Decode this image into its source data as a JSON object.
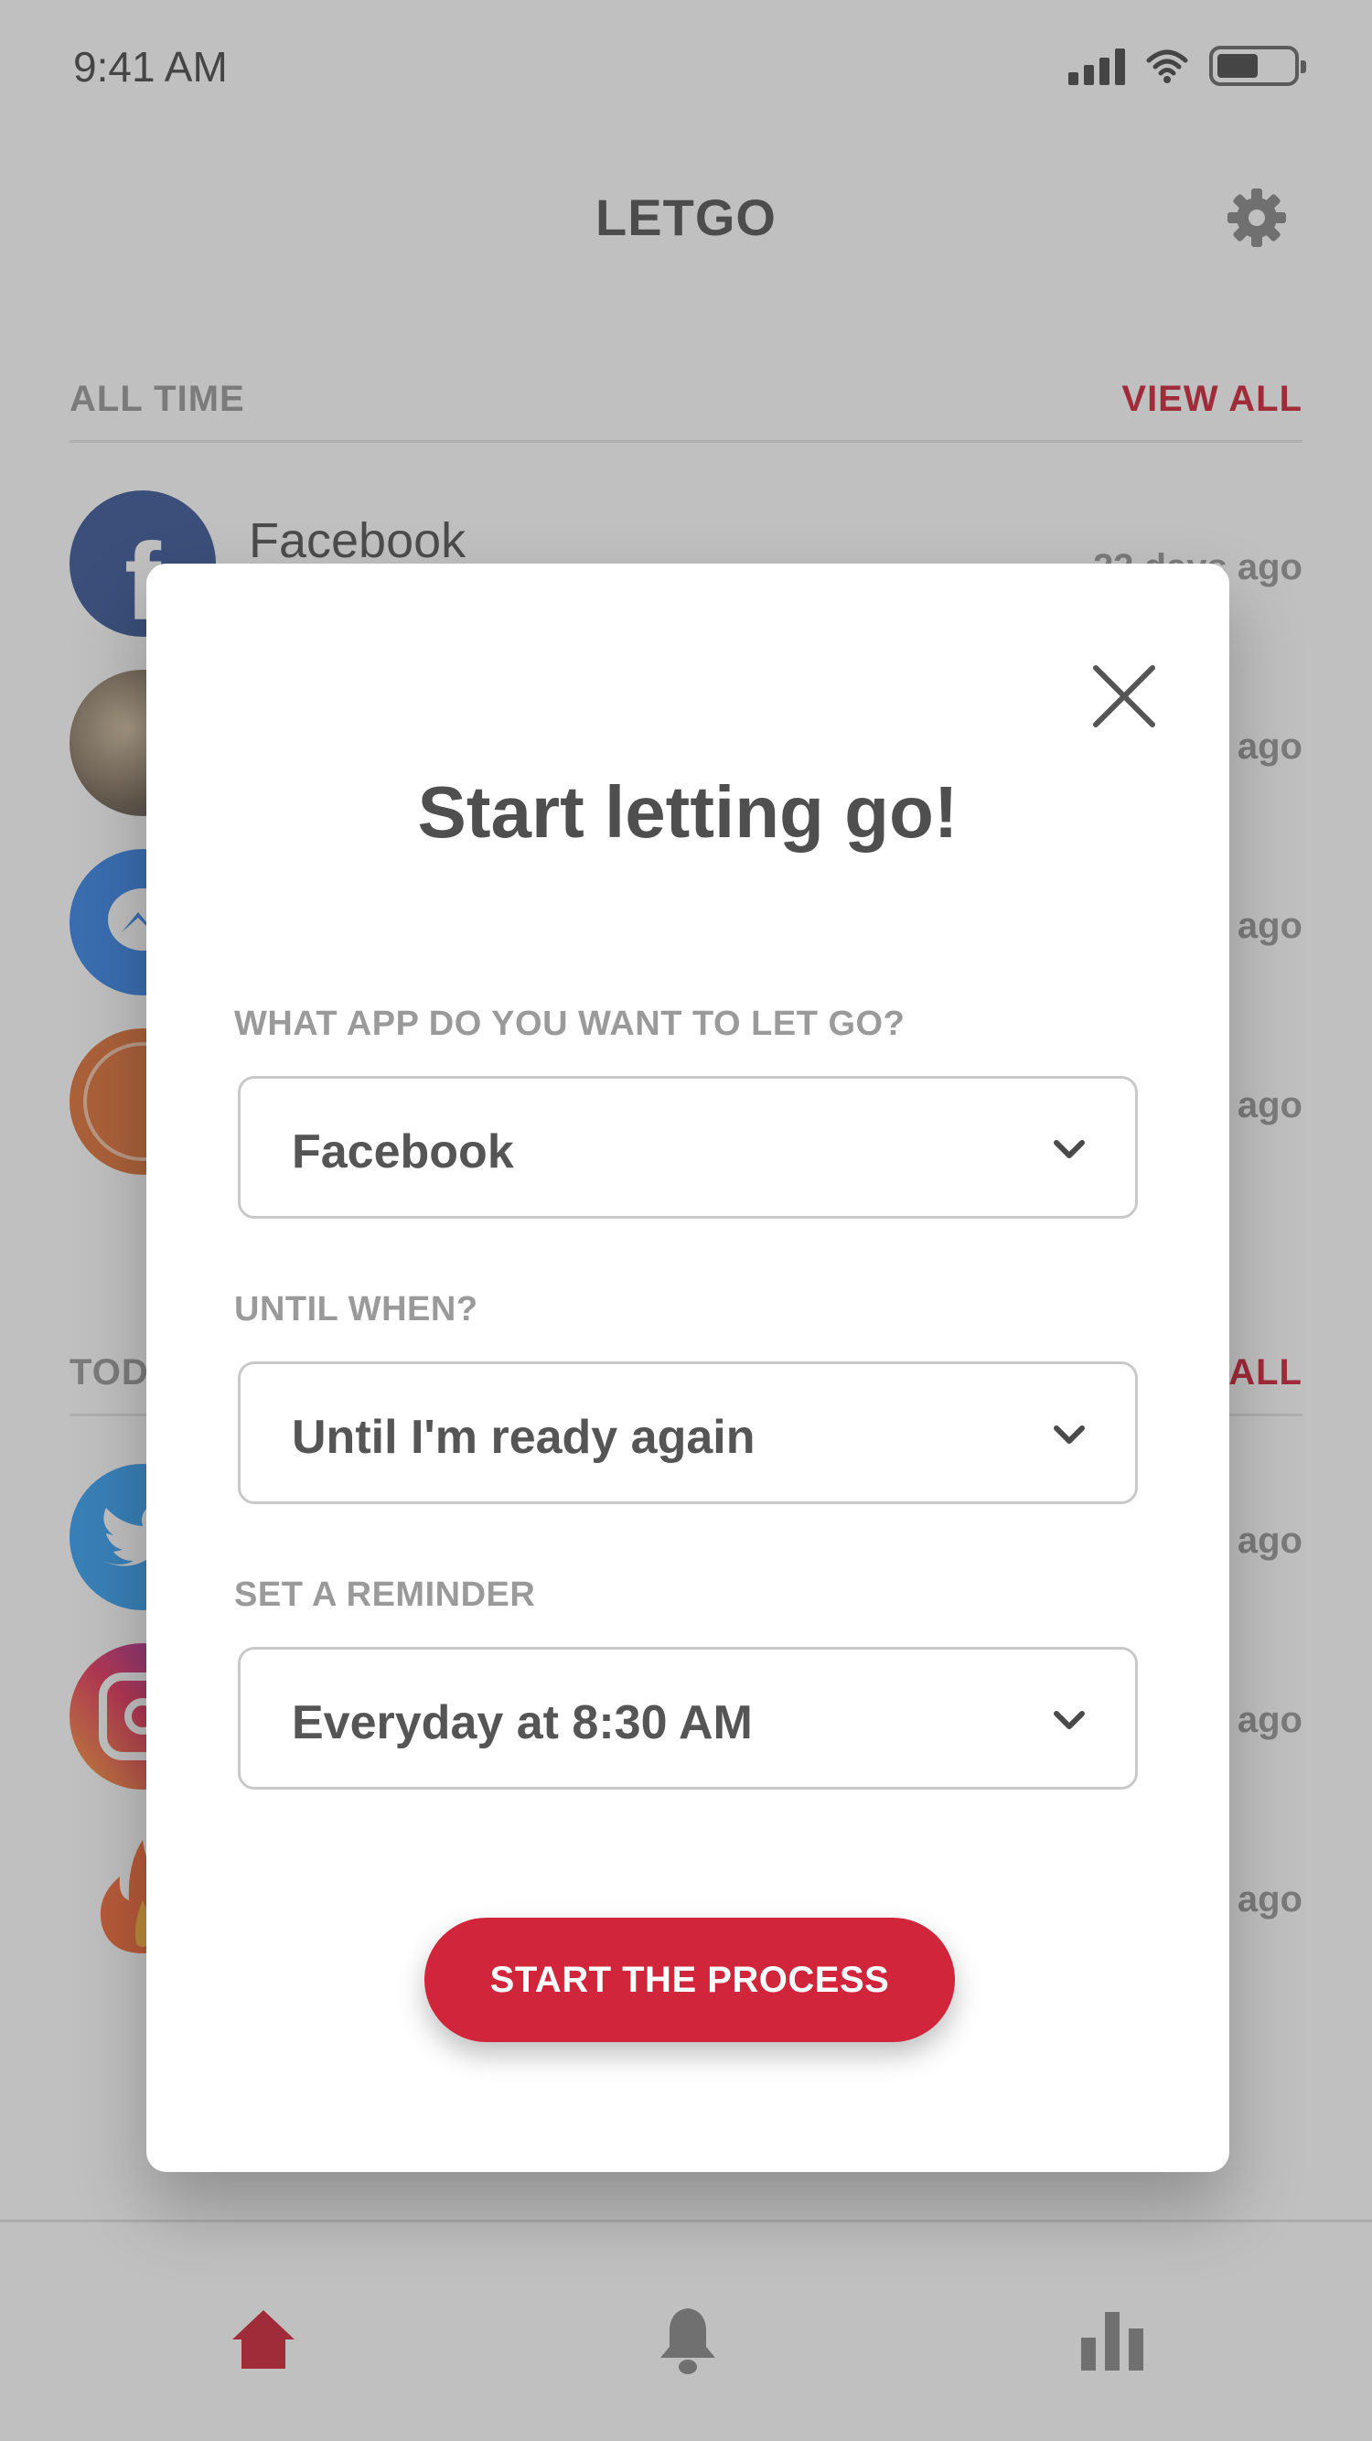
{
  "status_bar": {
    "time": "9:41 AM"
  },
  "header": {
    "title": "LETGO",
    "settings_icon": "gear-icon"
  },
  "all_time": {
    "label": "ALL TIME",
    "action": "VIEW ALL",
    "items": [
      {
        "name": "Facebook",
        "time": "23 days ago",
        "icon": "facebook-icon"
      },
      {
        "name": "",
        "time": "ago",
        "icon": "game-avatar-icon"
      },
      {
        "name": "",
        "time": "ago",
        "icon": "messenger-icon"
      },
      {
        "name": "",
        "time": "ago",
        "icon": "app-la-icon"
      }
    ]
  },
  "today": {
    "label": "TOD",
    "action": "ALL",
    "items": [
      {
        "time": "ago",
        "icon": "twitter-icon"
      },
      {
        "time": "ago",
        "icon": "instagram-icon"
      },
      {
        "time": "ago",
        "icon": "tinder-icon"
      }
    ]
  },
  "bottom_nav": {
    "items": [
      {
        "icon": "home-icon",
        "active": true
      },
      {
        "icon": "bell-icon",
        "active": false
      },
      {
        "icon": "bar-chart-icon",
        "active": false
      }
    ]
  },
  "modal": {
    "title": "Start letting go!",
    "close_icon": "close-icon",
    "app_field": {
      "label": "WHAT APP DO YOU WANT TO LET GO?",
      "value": "Facebook"
    },
    "until_field": {
      "label": "UNTIL WHEN?",
      "value": "Until I'm ready again"
    },
    "reminder_field": {
      "label": "SET A REMINDER",
      "value": "Everyday at 8:30 AM"
    },
    "cta_label": "START THE PROCESS"
  },
  "colors": {
    "accent": "#d0253a",
    "text": "#555555",
    "muted": "#9a9a9a",
    "overlay": "rgba(60,60,60,0.32)"
  }
}
